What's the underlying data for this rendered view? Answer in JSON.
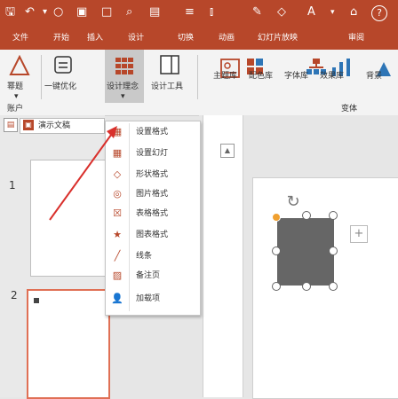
{
  "titlebar": {
    "icons": [
      "save-icon",
      "undo-icon",
      "slideshow-start-icon",
      "new-slide-icon",
      "find-icon",
      "layout-icon",
      "text-direction-icon",
      "pen-icon",
      "shape-fill-icon",
      "font-icon",
      "help-icon"
    ],
    "font_label": "A",
    "help_label": "?"
  },
  "tabs": [
    "文件",
    "开始",
    "插入",
    "设计",
    "切换",
    "动画",
    "幻灯片放映",
    "审阅"
  ],
  "ribbon": {
    "buttons": [
      {
        "label": "幂题",
        "icon": "shape-icon"
      },
      {
        "label": "一键优化",
        "icon": "optimize-icon"
      },
      {
        "label": "设计理念",
        "icon": "grid-icon"
      },
      {
        "label": "设计工具",
        "icon": "design-tools-icon"
      }
    ],
    "variant_labels": [
      "主题库",
      "配色库",
      "字体库",
      "效果库",
      "背景"
    ]
  },
  "group_labels": {
    "left": "账户",
    "right": "变体"
  },
  "slide_pane": {
    "tab_label": "演示文稿",
    "slides": [
      {
        "number": "1"
      },
      {
        "number": "2"
      }
    ]
  },
  "menu": {
    "items": [
      {
        "label": "设置格式",
        "icon": "grid-icon"
      },
      {
        "label": "设置幻灯",
        "icon": "grid-icon"
      },
      {
        "label": "形状格式",
        "icon": "diamond-icon"
      },
      {
        "label": "图片格式",
        "icon": "circle-icon"
      },
      {
        "label": "表格格式",
        "icon": "z-icon"
      },
      {
        "label": "图表格式",
        "icon": "star-icon"
      },
      {
        "label": "线条",
        "icon": "pen-icon"
      },
      {
        "label": "备注页",
        "icon": "notes-icon"
      },
      {
        "label": "加载项",
        "icon": "person-icon"
      }
    ]
  },
  "colors": {
    "accent": "#b7472a",
    "shape_fill": "#666666",
    "handle": "#f0a030"
  }
}
